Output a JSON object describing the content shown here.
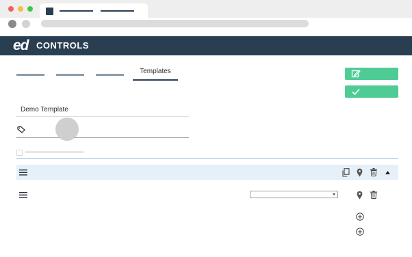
{
  "browser": {
    "tab_title": "",
    "address": ""
  },
  "app": {
    "logo_mark": "ed",
    "logo_text": "CONTROLS",
    "brand_color": "#2a3e52",
    "accent_color": "#4fcc96"
  },
  "nav": {
    "tabs": [
      "",
      "",
      "",
      "Templates"
    ],
    "active_tab": "Templates"
  },
  "actions": {
    "edit_icon": "edit-icon",
    "confirm_icon": "check-icon"
  },
  "form": {
    "template_name": "Demo Template",
    "tags_icon": "tag-icon"
  },
  "section": {
    "header_icons": [
      "hamburger-icon",
      "copy-icon",
      "location-pin-icon",
      "trash-icon",
      "caret-up-icon"
    ],
    "row_icons": [
      "hamburger-icon",
      "location-pin-icon",
      "trash-icon"
    ],
    "select_value": "",
    "add_icons": [
      "plus-circle-icon",
      "plus-circle-icon"
    ]
  }
}
